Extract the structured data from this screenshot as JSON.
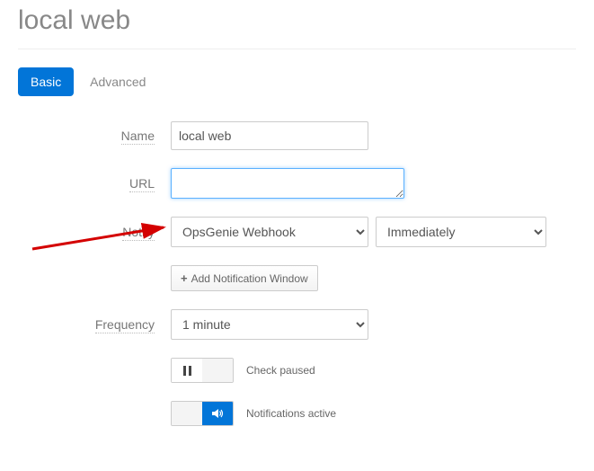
{
  "page_title": "local web",
  "tabs": {
    "basic": "Basic",
    "advanced": "Advanced"
  },
  "labels": {
    "name": "Name",
    "url": "URL",
    "notify": "Notify",
    "frequency": "Frequency"
  },
  "fields": {
    "name_value": "local web",
    "url_value": "",
    "notify_target": "OpsGenie Webhook",
    "notify_when": "Immediately",
    "frequency": "1 minute"
  },
  "buttons": {
    "add_notification_window": "Add Notification Window"
  },
  "status": {
    "check_paused": "Check paused",
    "notifications_active": "Notifications active"
  }
}
